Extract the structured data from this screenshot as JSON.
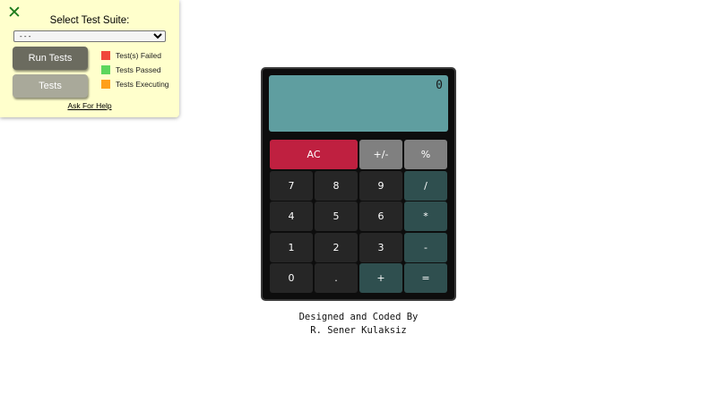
{
  "test_panel": {
    "close_icon": "close-x-icon",
    "title": "Select Test Suite:",
    "select_value": "- - -",
    "run_tests_label": "Run Tests",
    "tests_label": "Tests",
    "legend": [
      {
        "label": "Test(s) Failed",
        "color": "#f0473a"
      },
      {
        "label": "Tests Passed",
        "color": "#5cd65c"
      },
      {
        "label": "Tests Executing",
        "color": "#ff9f1a"
      }
    ],
    "help_link": "Ask For Help"
  },
  "calculator": {
    "display_value": "0",
    "keys": [
      {
        "label": "AC",
        "type": "clear"
      },
      {
        "label": "+/-",
        "type": "func"
      },
      {
        "label": "%",
        "type": "func"
      },
      {
        "label": "7",
        "type": "num"
      },
      {
        "label": "8",
        "type": "num"
      },
      {
        "label": "9",
        "type": "num"
      },
      {
        "label": "/",
        "type": "op"
      },
      {
        "label": "4",
        "type": "num"
      },
      {
        "label": "5",
        "type": "num"
      },
      {
        "label": "6",
        "type": "num"
      },
      {
        "label": "*",
        "type": "op"
      },
      {
        "label": "1",
        "type": "num"
      },
      {
        "label": "2",
        "type": "num"
      },
      {
        "label": "3",
        "type": "num"
      },
      {
        "label": "-",
        "type": "op"
      },
      {
        "label": "0",
        "type": "num"
      },
      {
        "label": ".",
        "type": "num"
      },
      {
        "label": "+",
        "type": "op"
      },
      {
        "label": "=",
        "type": "op"
      }
    ]
  },
  "credits": {
    "line1": "Designed and Coded By",
    "line2": "R. Sener Kulaksiz"
  }
}
